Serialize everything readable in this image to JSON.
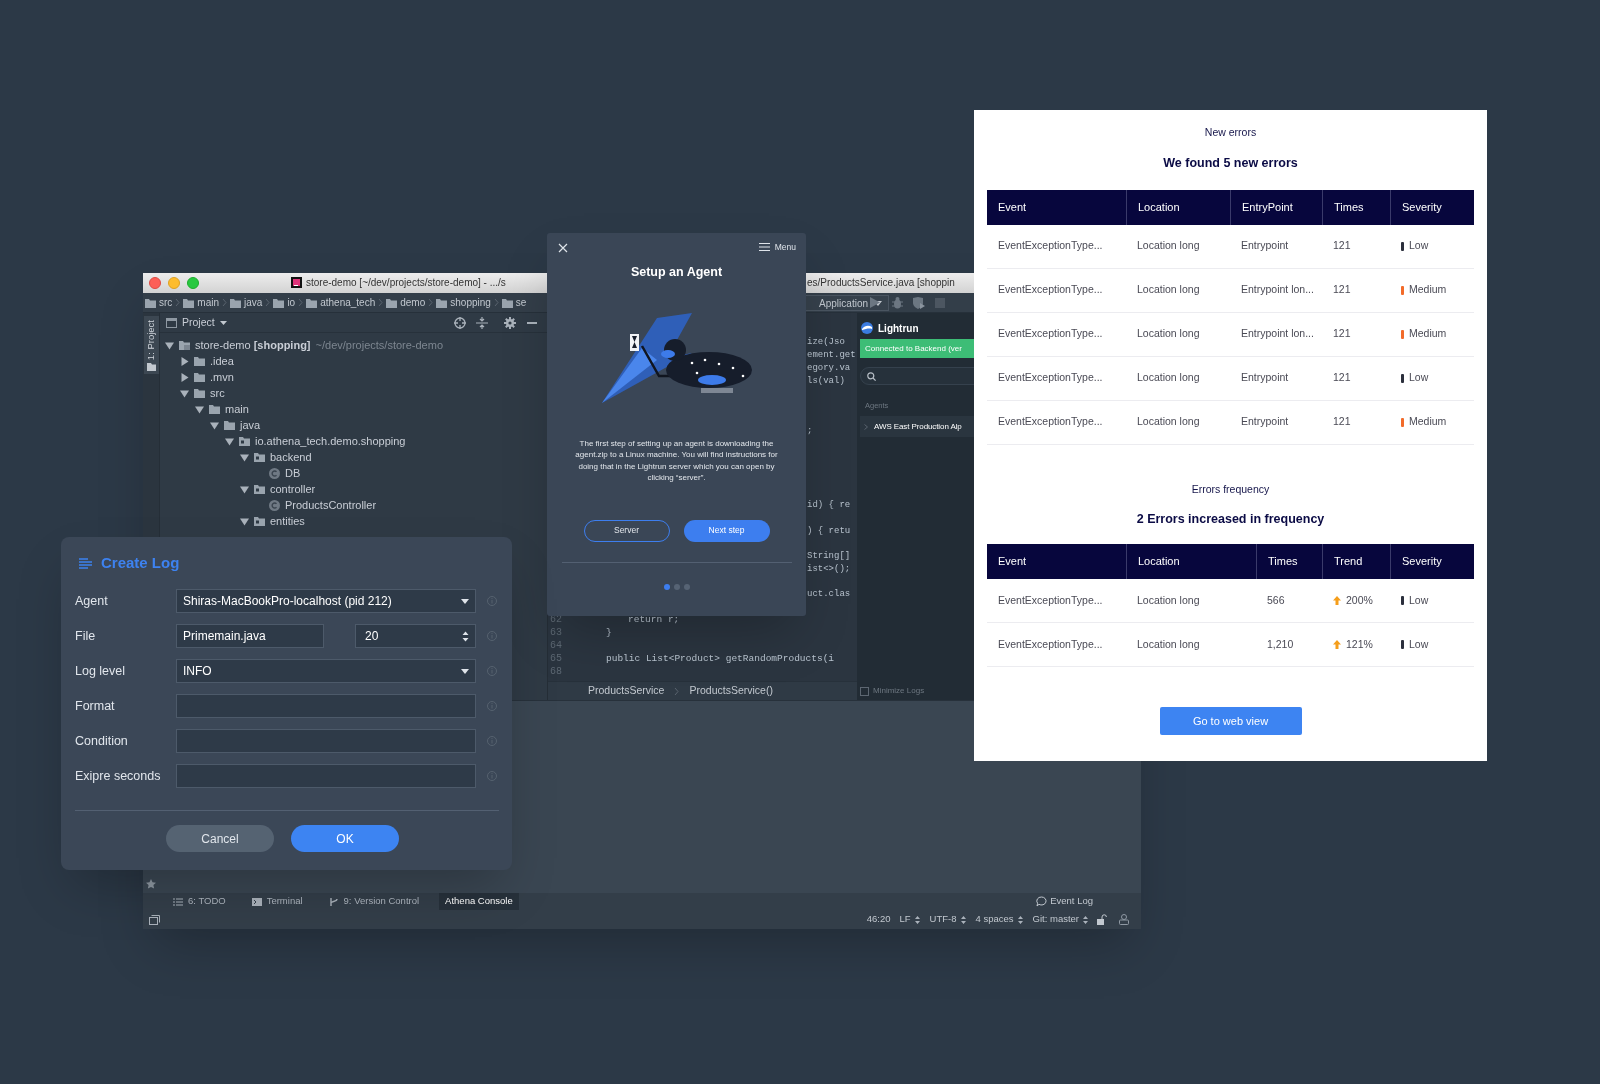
{
  "ide": {
    "title_left": "store-demo [~/dev/projects/store-demo] - .../s",
    "title_right": "es/ProductsService.java [shoppin",
    "breadcrumbs": [
      "src",
      "main",
      "java",
      "io",
      "athena_tech",
      "demo",
      "shopping",
      "se"
    ],
    "run_config": "Application",
    "side_tab": "1: Project",
    "project_header": "Project",
    "tree": [
      {
        "label": "store-demo **[shopping]**",
        "path": "~/dev/projects/store-demo",
        "kind": "module",
        "expanded": true,
        "children": [
          {
            "label": ".idea",
            "kind": "folder",
            "expanded": false
          },
          {
            "label": ".mvn",
            "kind": "folder",
            "expanded": false
          },
          {
            "label": "src",
            "kind": "folder",
            "expanded": true,
            "children": [
              {
                "label": "main",
                "kind": "folder",
                "expanded": true,
                "children": [
                  {
                    "label": "java",
                    "kind": "folder",
                    "expanded": true,
                    "children": [
                      {
                        "label": "io.athena_tech.demo.shopping",
                        "kind": "package",
                        "expanded": true,
                        "children": [
                          {
                            "label": "backend",
                            "kind": "package",
                            "expanded": true,
                            "children": [
                              {
                                "label": "DB",
                                "kind": "class"
                              }
                            ]
                          },
                          {
                            "label": "controller",
                            "kind": "package",
                            "expanded": true,
                            "children": [
                              {
                                "label": "ProductsController",
                                "kind": "class"
                              }
                            ]
                          },
                          {
                            "label": "entities",
                            "kind": "package",
                            "expanded": true
                          }
                        ]
                      }
                    ]
                  }
                ]
              }
            ]
          }
        ]
      }
    ],
    "code_fragments": [
      "ize(Jso",
      "ement.get",
      "egory.va",
      "ls(val)",
      ";",
      "id) { re",
      ") { retu",
      "String[]",
      "ist<>();",
      "uct.clas"
    ],
    "code_lines": [
      {
        "number": "62",
        "text": "return r;"
      },
      {
        "number": "63",
        "text": "}"
      },
      {
        "number": "64"
      },
      {
        "number": "65",
        "text": "public List<Product> getRandomProducts(i"
      },
      {
        "number": "68"
      }
    ],
    "editor_breadcrumbs": [
      "ProductsService",
      "ProductsService()"
    ],
    "lightrun": {
      "title": "Lightrun",
      "status": "Connected to Backend (ver",
      "section": "Agents",
      "agents": [
        "AWS East Production Alp"
      ],
      "minimize_logs": {
        "label": "Minimize Logs",
        "checked": false
      }
    },
    "tool_tabs": [
      {
        "label": "6: TODO",
        "kind": "list",
        "selected": false
      },
      {
        "label": "Terminal",
        "kind": "terminal",
        "selected": false
      },
      {
        "label": "9: Version Control",
        "kind": "vcs",
        "selected": false
      },
      {
        "label": "Athena Console",
        "kind": "plain",
        "selected": true
      }
    ],
    "event_log": "Event Log",
    "status": [
      "46:20",
      "LF",
      "UTF-8",
      "4 spaces",
      "Git: master"
    ]
  },
  "setup_dialog": {
    "title": "Setup an Agent",
    "menu": "Menu",
    "body": "The first step of setting up an agent is downloading the agent.zip to a Linux machine. You will find instructions for doing that in the Lightrun server which you can open by clicking “server”.",
    "secondary_button": "Server",
    "primary_button": "Next step",
    "pages": [
      {
        "selected": true
      },
      {
        "selected": false
      },
      {
        "selected": false
      }
    ]
  },
  "create_log": {
    "title": "Create Log",
    "fields": [
      {
        "label": "Agent",
        "kind": "select",
        "value": "Shiras-MacBookPro-localhost (pid 212)"
      },
      {
        "label": "File",
        "kind": "file_line",
        "value": "Primemain.java",
        "line": "20"
      },
      {
        "label": "Log level",
        "kind": "select",
        "value": "INFO"
      },
      {
        "label": "Format",
        "kind": "text"
      },
      {
        "label": "Condition",
        "kind": "text"
      },
      {
        "label": "Exipre seconds",
        "kind": "text"
      }
    ],
    "cancel": "Cancel",
    "ok": "OK"
  },
  "errors_panel": {
    "new_title": "New errors",
    "new_heading": "We found 5 new errors",
    "new_columns": [
      "Event",
      "Location",
      "EntryPoint",
      "Times",
      "Severity"
    ],
    "new_rows": [
      {
        "event": "EventExceptionType...",
        "location": "Location long",
        "entrypoint": "Entrypoint",
        "times": "121",
        "severity": "Low",
        "color": "#2b2f3c"
      },
      {
        "event": "EventExceptionType...",
        "location": "Location long",
        "entrypoint": "Entrypoint lon...",
        "times": "121",
        "severity": "Medium",
        "color": "#f26b2a"
      },
      {
        "event": "EventExceptionType...",
        "location": "Location long",
        "entrypoint": "Entrypoint lon...",
        "times": "121",
        "severity": "Medium",
        "color": "#f26b2a"
      },
      {
        "event": "EventExceptionType...",
        "location": "Location long",
        "entrypoint": "Entrypoint",
        "times": "121",
        "severity": "Low",
        "color": "#2b2f3c"
      },
      {
        "event": "EventExceptionType...",
        "location": "Location long",
        "entrypoint": "Entrypoint",
        "times": "121",
        "severity": "Medium",
        "color": "#f26b2a"
      }
    ],
    "freq_title": "Errors frequency",
    "freq_heading": "2 Errors increased in frequency",
    "freq_columns": [
      "Event",
      "Location",
      "Times",
      "Trend",
      "Severity"
    ],
    "freq_rows": [
      {
        "event": "EventExceptionType...",
        "location": "Location long",
        "times": "566",
        "trend": "200%",
        "severity": "Low",
        "color": "#2b2f3c"
      },
      {
        "event": "EventExceptionType...",
        "location": "Location long",
        "times": "1,210",
        "trend": "121%",
        "severity": "Low",
        "color": "#2b2f3c"
      }
    ],
    "button": "Go to web view"
  }
}
